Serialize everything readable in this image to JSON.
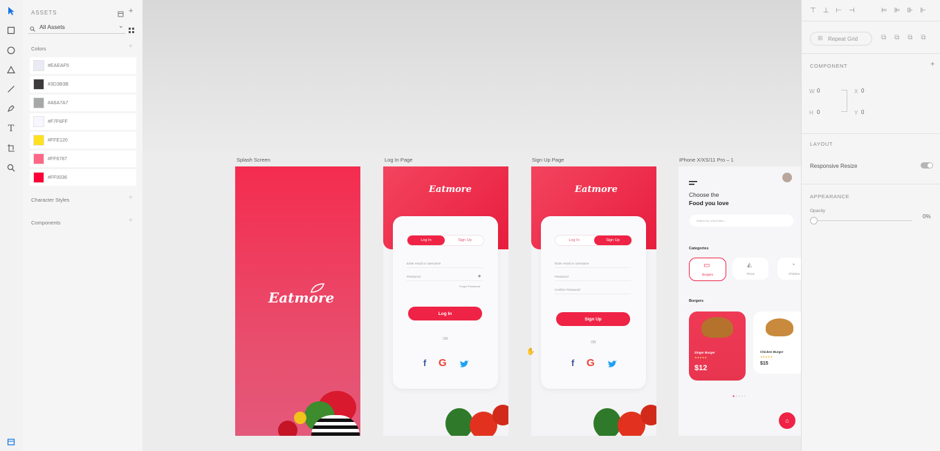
{
  "tools": [
    "select-tool",
    "rectangle-tool",
    "ellipse-tool",
    "triangle-tool",
    "line-tool",
    "pen-tool",
    "text-tool",
    "artboard-tool",
    "zoom-tool"
  ],
  "assets": {
    "title": "ASSETS",
    "filter": "All Assets",
    "colors_label": "Colors",
    "colors": [
      {
        "label": "#EAEAF5",
        "hex": "#EAEAF5"
      },
      {
        "label": "#3D3B3B",
        "hex": "#3D3B3B"
      },
      {
        "label": "#A6A7A7",
        "hex": "#A6A7A7"
      },
      {
        "label": "#F7F6FF",
        "hex": "#F7F6FF"
      },
      {
        "label": "#FFE120",
        "hex": "#FFE120"
      },
      {
        "label": "#FF6787",
        "hex": "#FF6787"
      },
      {
        "label": "#FF0036",
        "hex": "#FF0036"
      }
    ],
    "character_styles_label": "Character Styles",
    "components_label": "Components"
  },
  "artboards": {
    "splash": {
      "label": "Splash Screen",
      "logo": "Eatmore"
    },
    "login": {
      "label": "Log In Page",
      "logo": "Eatmore",
      "tab_login": "Log In",
      "tab_signup": "Sign Up",
      "field_user": "Enter email or username",
      "field_password": "Password",
      "forgot": "Forgot Password",
      "button": "Log In",
      "or": "OR"
    },
    "signup": {
      "label": "Sign Up Page",
      "logo": "Eatmore",
      "tab_login": "Log In",
      "tab_signup": "Sign Up",
      "field_user": "Enter email or username",
      "field_password": "Password",
      "field_confirm": "Confirm Password",
      "button": "Sign Up",
      "or": "OR"
    },
    "home": {
      "label": "iPhone X/XS/11 Pro – 1",
      "title_line1": "Choose the",
      "title_line2": "Food you love",
      "search_placeholder": "Search for a food item...",
      "categories_label": "Categories",
      "categories": [
        "Burgers",
        "Pizza",
        "Chicken"
      ],
      "section_label": "Burgers",
      "items": [
        {
          "name": "Zinger Burger",
          "price": "$12"
        },
        {
          "name": "Chicken Burger",
          "price": "$15"
        }
      ]
    }
  },
  "properties": {
    "repeat_grid": "Repeat Grid",
    "component_label": "COMPONENT",
    "w_label": "W",
    "w_value": "0",
    "h_label": "H",
    "h_value": "0",
    "x_label": "X",
    "x_value": "0",
    "y_label": "Y",
    "y_value": "0",
    "layout_label": "LAYOUT",
    "responsive_resize": "Responsive Resize",
    "appearance_label": "APPEARANCE",
    "opacity_label": "Opacity",
    "opacity_value": "0%"
  },
  "colors": {
    "brand_red": "#EF2345",
    "accent_blue": "#1473E6"
  }
}
